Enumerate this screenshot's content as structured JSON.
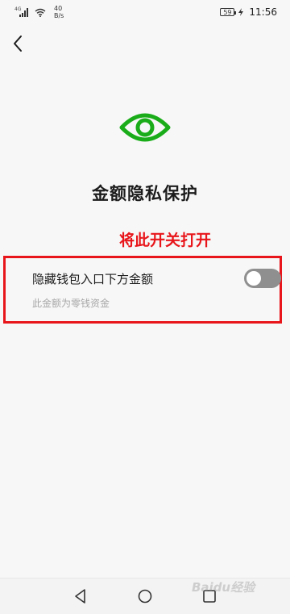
{
  "status_bar": {
    "network": "4G",
    "speed_value": "40",
    "speed_unit": "B/s",
    "battery": "59",
    "time": "11:56"
  },
  "header": {
    "back_icon": "chevron-left-icon"
  },
  "main": {
    "hero_icon": "eye-icon",
    "title": "金额隐私保护",
    "annotation": "将此开关打开",
    "setting": {
      "label": "隐藏钱包入口下方金额",
      "description": "此金额为零钱资金",
      "toggle_on": false
    }
  },
  "nav_bar": {
    "back_icon": "triangle-back-icon",
    "home_icon": "circle-home-icon",
    "recent_icon": "square-recent-icon"
  },
  "watermark": {
    "text": "Baidu经验"
  },
  "colors": {
    "accent_green": "#1aad19",
    "annotation_red": "#e8161b",
    "toggle_off": "#8f8f8f",
    "background": "#f7f7f7"
  }
}
